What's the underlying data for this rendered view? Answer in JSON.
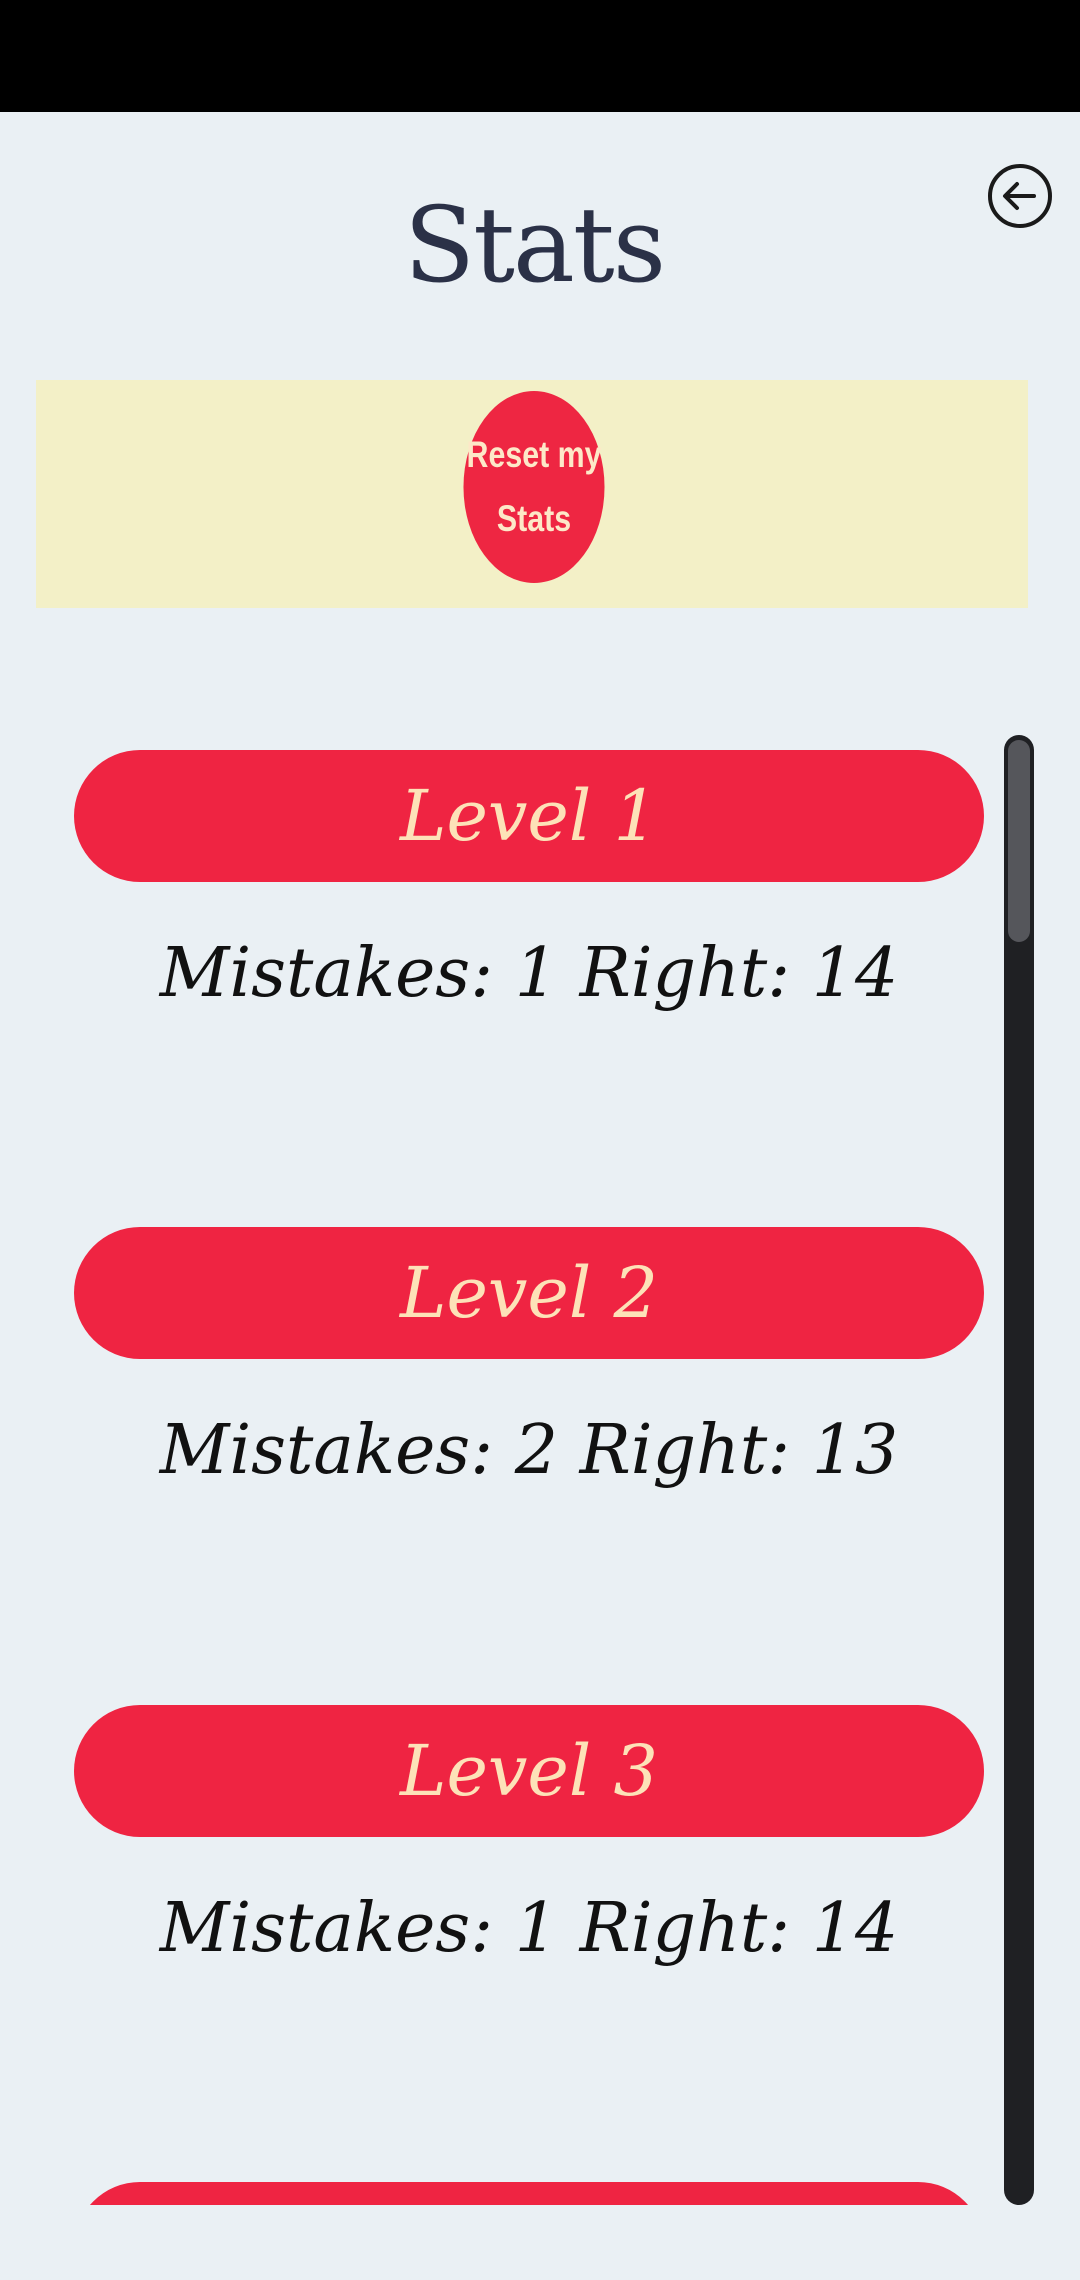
{
  "header": {
    "title": "Stats",
    "back_icon": "arrow-left-circle-icon"
  },
  "reset": {
    "label_line1": "Reset my",
    "label_line2": "Stats"
  },
  "colors": {
    "background": "#eaf0f4",
    "accent": "#ef2442",
    "banner": "#f3f0c7",
    "title": "#2b3147",
    "level_text": "#fde2b8"
  },
  "levels": [
    {
      "label": "Level 1",
      "stats": "Mistakes: 1 Right: 14"
    },
    {
      "label": "Level 2",
      "stats": "Mistakes: 2 Right: 13"
    },
    {
      "label": "Level 3",
      "stats": "Mistakes: 1 Right: 14"
    }
  ]
}
